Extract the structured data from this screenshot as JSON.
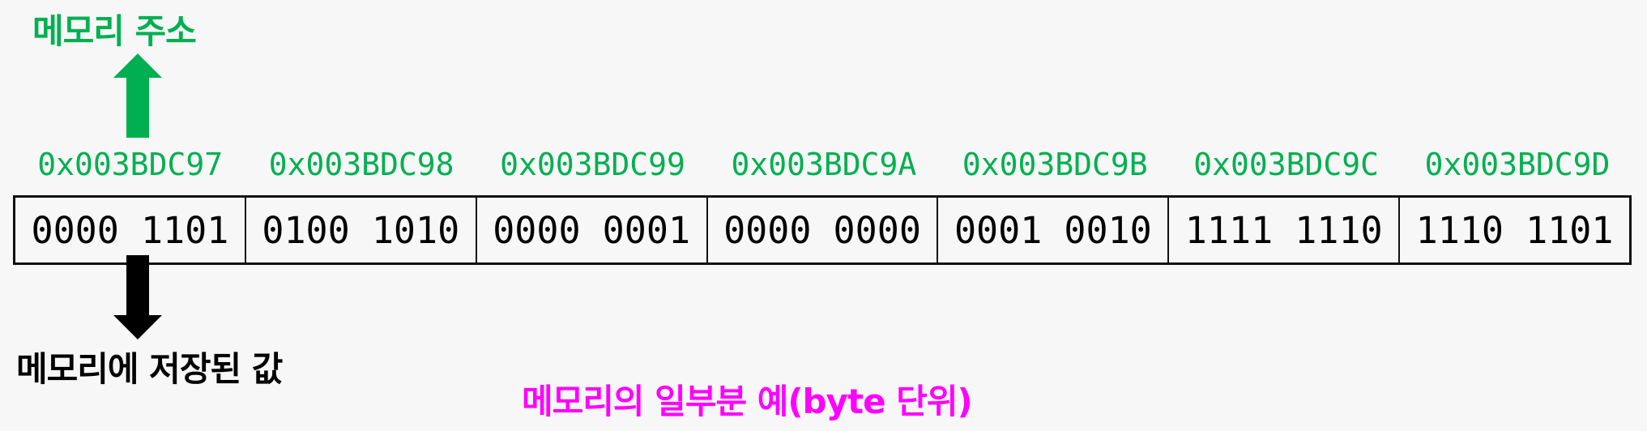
{
  "labels": {
    "memory_address": "메모리 주소",
    "stored_value": "메모리에 저장된 값",
    "caption": "메모리의 일부분 예(byte 단위)"
  },
  "addresses": [
    "0x003BDC97",
    "0x003BDC98",
    "0x003BDC99",
    "0x003BDC9A",
    "0x003BDC9B",
    "0x003BDC9C",
    "0x003BDC9D"
  ],
  "bytes": [
    "0000 1101",
    "0100 1010",
    "0000 0001",
    "0000 0000",
    "0001 0010",
    "1111 1110",
    "1110 1101"
  ],
  "colors": {
    "address": "#00b050",
    "caption": "#ff00ff",
    "value_arrow": "#000000"
  },
  "icons": {
    "up": "arrow-up-icon",
    "down": "arrow-down-icon"
  }
}
